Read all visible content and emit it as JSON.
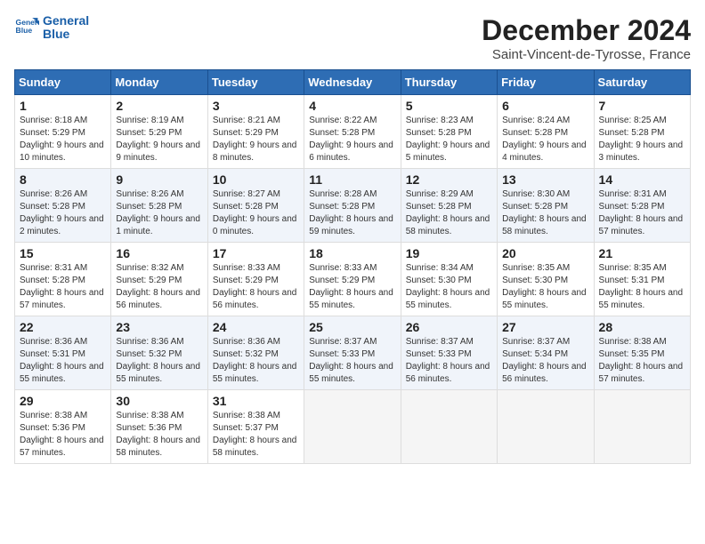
{
  "header": {
    "logo_line1": "General",
    "logo_line2": "Blue",
    "title": "December 2024",
    "subtitle": "Saint-Vincent-de-Tyrosse, France"
  },
  "weekdays": [
    "Sunday",
    "Monday",
    "Tuesday",
    "Wednesday",
    "Thursday",
    "Friday",
    "Saturday"
  ],
  "weeks": [
    [
      {
        "day": "1",
        "sunrise": "8:18 AM",
        "sunset": "5:29 PM",
        "daylight": "9 hours and 10 minutes."
      },
      {
        "day": "2",
        "sunrise": "8:19 AM",
        "sunset": "5:29 PM",
        "daylight": "9 hours and 9 minutes."
      },
      {
        "day": "3",
        "sunrise": "8:21 AM",
        "sunset": "5:29 PM",
        "daylight": "9 hours and 8 minutes."
      },
      {
        "day": "4",
        "sunrise": "8:22 AM",
        "sunset": "5:28 PM",
        "daylight": "9 hours and 6 minutes."
      },
      {
        "day": "5",
        "sunrise": "8:23 AM",
        "sunset": "5:28 PM",
        "daylight": "9 hours and 5 minutes."
      },
      {
        "day": "6",
        "sunrise": "8:24 AM",
        "sunset": "5:28 PM",
        "daylight": "9 hours and 4 minutes."
      },
      {
        "day": "7",
        "sunrise": "8:25 AM",
        "sunset": "5:28 PM",
        "daylight": "9 hours and 3 minutes."
      }
    ],
    [
      {
        "day": "8",
        "sunrise": "8:26 AM",
        "sunset": "5:28 PM",
        "daylight": "9 hours and 2 minutes."
      },
      {
        "day": "9",
        "sunrise": "8:26 AM",
        "sunset": "5:28 PM",
        "daylight": "9 hours and 1 minute."
      },
      {
        "day": "10",
        "sunrise": "8:27 AM",
        "sunset": "5:28 PM",
        "daylight": "9 hours and 0 minutes."
      },
      {
        "day": "11",
        "sunrise": "8:28 AM",
        "sunset": "5:28 PM",
        "daylight": "8 hours and 59 minutes."
      },
      {
        "day": "12",
        "sunrise": "8:29 AM",
        "sunset": "5:28 PM",
        "daylight": "8 hours and 58 minutes."
      },
      {
        "day": "13",
        "sunrise": "8:30 AM",
        "sunset": "5:28 PM",
        "daylight": "8 hours and 58 minutes."
      },
      {
        "day": "14",
        "sunrise": "8:31 AM",
        "sunset": "5:28 PM",
        "daylight": "8 hours and 57 minutes."
      }
    ],
    [
      {
        "day": "15",
        "sunrise": "8:31 AM",
        "sunset": "5:28 PM",
        "daylight": "8 hours and 57 minutes."
      },
      {
        "day": "16",
        "sunrise": "8:32 AM",
        "sunset": "5:29 PM",
        "daylight": "8 hours and 56 minutes."
      },
      {
        "day": "17",
        "sunrise": "8:33 AM",
        "sunset": "5:29 PM",
        "daylight": "8 hours and 56 minutes."
      },
      {
        "day": "18",
        "sunrise": "8:33 AM",
        "sunset": "5:29 PM",
        "daylight": "8 hours and 55 minutes."
      },
      {
        "day": "19",
        "sunrise": "8:34 AM",
        "sunset": "5:30 PM",
        "daylight": "8 hours and 55 minutes."
      },
      {
        "day": "20",
        "sunrise": "8:35 AM",
        "sunset": "5:30 PM",
        "daylight": "8 hours and 55 minutes."
      },
      {
        "day": "21",
        "sunrise": "8:35 AM",
        "sunset": "5:31 PM",
        "daylight": "8 hours and 55 minutes."
      }
    ],
    [
      {
        "day": "22",
        "sunrise": "8:36 AM",
        "sunset": "5:31 PM",
        "daylight": "8 hours and 55 minutes."
      },
      {
        "day": "23",
        "sunrise": "8:36 AM",
        "sunset": "5:32 PM",
        "daylight": "8 hours and 55 minutes."
      },
      {
        "day": "24",
        "sunrise": "8:36 AM",
        "sunset": "5:32 PM",
        "daylight": "8 hours and 55 minutes."
      },
      {
        "day": "25",
        "sunrise": "8:37 AM",
        "sunset": "5:33 PM",
        "daylight": "8 hours and 55 minutes."
      },
      {
        "day": "26",
        "sunrise": "8:37 AM",
        "sunset": "5:33 PM",
        "daylight": "8 hours and 56 minutes."
      },
      {
        "day": "27",
        "sunrise": "8:37 AM",
        "sunset": "5:34 PM",
        "daylight": "8 hours and 56 minutes."
      },
      {
        "day": "28",
        "sunrise": "8:38 AM",
        "sunset": "5:35 PM",
        "daylight": "8 hours and 57 minutes."
      }
    ],
    [
      {
        "day": "29",
        "sunrise": "8:38 AM",
        "sunset": "5:36 PM",
        "daylight": "8 hours and 57 minutes."
      },
      {
        "day": "30",
        "sunrise": "8:38 AM",
        "sunset": "5:36 PM",
        "daylight": "8 hours and 58 minutes."
      },
      {
        "day": "31",
        "sunrise": "8:38 AM",
        "sunset": "5:37 PM",
        "daylight": "8 hours and 58 minutes."
      },
      null,
      null,
      null,
      null
    ]
  ],
  "labels": {
    "sunrise": "Sunrise:",
    "sunset": "Sunset:",
    "daylight": "Daylight:"
  }
}
